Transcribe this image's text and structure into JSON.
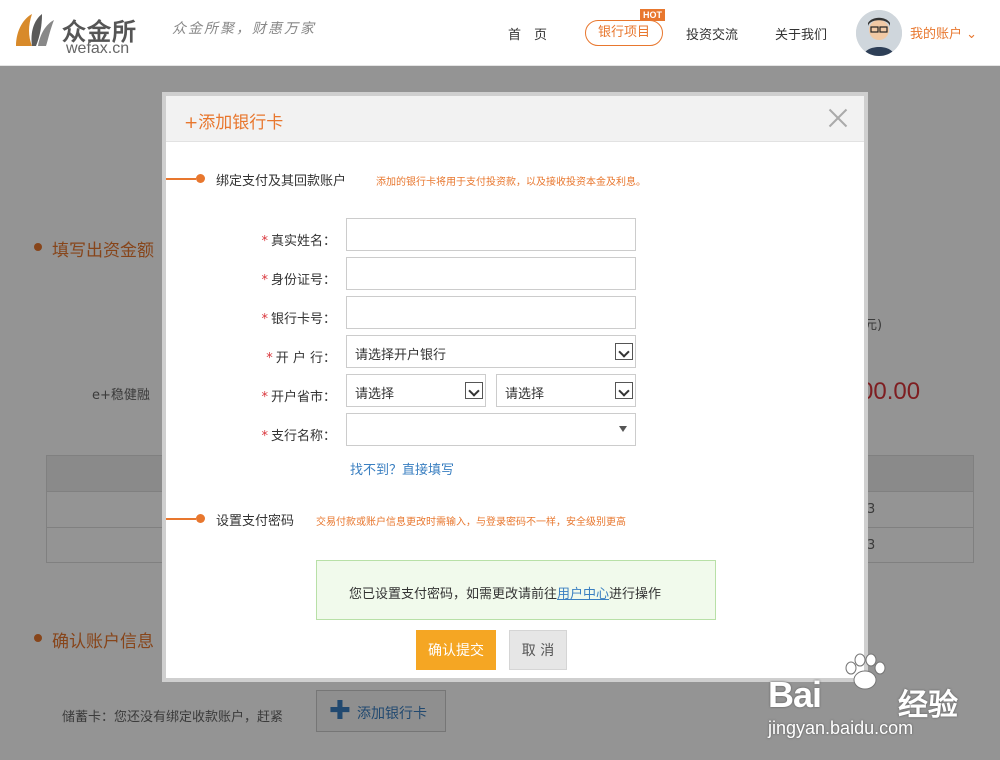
{
  "header": {
    "logo_cn": "众金所",
    "logo_en": "wefax.cn",
    "slogan": "众金所聚，财惠万家",
    "nav": {
      "home": "首　页",
      "bank_projects": "银行项目",
      "hot_badge": "HOT",
      "invest_exchange": "投资交流",
      "about": "关于我们",
      "my_account": "我的账户"
    }
  },
  "background": {
    "section_amount": "填写出资金额",
    "product_label": "e+稳健融",
    "unit_hint": "元)",
    "amount_value": "00.00",
    "section_confirm": "确认账户信息",
    "savings_card_text": "储蓄卡：您还没有绑定收款账户，赶紧",
    "add_card_button": "添加银行卡",
    "table_cells": [
      "3",
      "3"
    ]
  },
  "modal": {
    "title": "+添加银行卡",
    "step1": {
      "title": "绑定支付及其回款账户",
      "note": "添加的银行卡将用于支付投资款，以及接收投资本金及利息。"
    },
    "form": {
      "real_name": {
        "label": "真实姓名：",
        "value": ""
      },
      "id_number": {
        "label": "身份证号：",
        "value": ""
      },
      "card_number": {
        "label": "银行卡号：",
        "value": ""
      },
      "bank": {
        "label": "开 户 行：",
        "selected": "请选择开户银行"
      },
      "province_city": {
        "label": "开户省市：",
        "province_selected": "请选择",
        "city_selected": "请选择"
      },
      "branch": {
        "label": "支行名称：",
        "selected": ""
      },
      "not_found_link": "找不到？直接填写"
    },
    "step2": {
      "title": "设置支付密码",
      "note": "交易付款或账户信息更改时需输入，与登录密码不一样，安全级别更高"
    },
    "notice": {
      "prefix": "您已设置支付密码，如需更改请前往",
      "link": "用户中心",
      "suffix": "进行操作"
    },
    "buttons": {
      "submit": "确认提交",
      "cancel": "取 消"
    }
  },
  "watermark": {
    "brand": "Bai",
    "brand_cn": "经验",
    "url": "jingyan.baidu.com"
  },
  "colors": {
    "accent": "#e8772e",
    "submit": "#f5a623",
    "link": "#3a7fc1",
    "notice_bg": "#f1faec",
    "required": "#d9343a"
  }
}
